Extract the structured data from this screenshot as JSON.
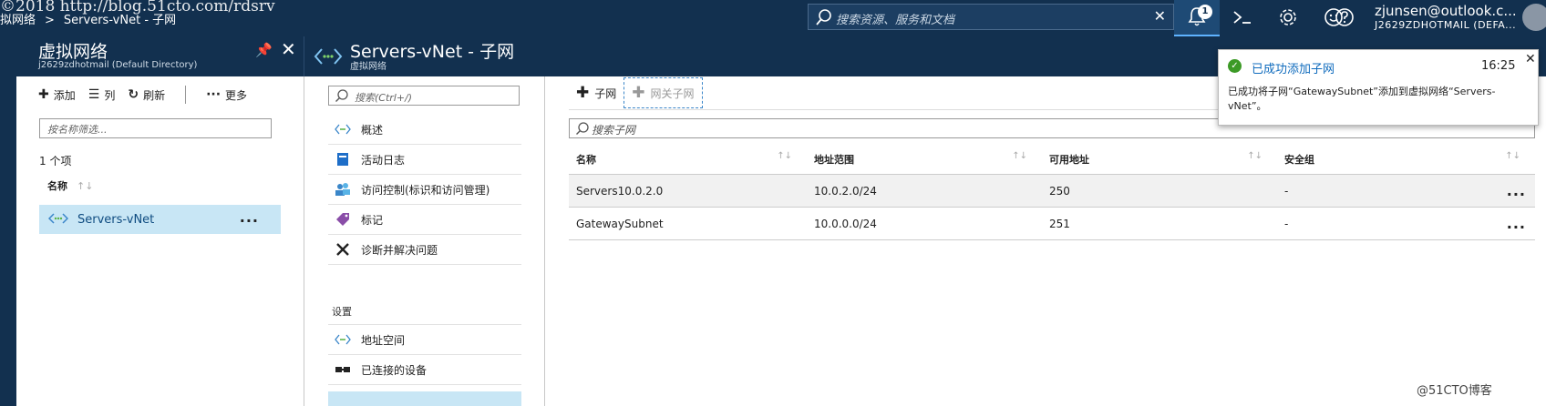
{
  "watermark": "©2018 http://blog.51cto.com/rdsrv",
  "breadcrumb": {
    "item1": "拟网络",
    "separator": ">",
    "item2": "Servers-vNet - 子网"
  },
  "global_search": {
    "placeholder": "搜索资源、服务和文档"
  },
  "notifications": {
    "count": "1"
  },
  "user": {
    "email": "zjunsen@outlook.c...",
    "directory": "J2629ZDHOTMAIL (DEFA..."
  },
  "blade1": {
    "title": "虚拟网络",
    "subtitle": "j2629zdhotmail (Default Directory)",
    "toolbar": {
      "add": "添加",
      "columns": "列",
      "refresh": "刷新",
      "more": "更多"
    },
    "filter_placeholder": "按名称筛选...",
    "count": "1 个项",
    "column_name": "名称",
    "sort_glyph": "↑↓",
    "rows": [
      {
        "name": "Servers-vNet",
        "more": "..."
      }
    ]
  },
  "blade2": {
    "title": "Servers-vNet - 子网",
    "subtitle": "虚拟网络",
    "menu_search_placeholder": "搜索(Ctrl+/)",
    "menu": {
      "overview": "概述",
      "activity_log": "活动日志",
      "access_control": "访问控制(标识和访问管理)",
      "tags": "标记",
      "diagnose": "诊断并解决问题",
      "section_settings": "设置",
      "address_space": "地址空间",
      "connected_devices": "已连接的设备"
    },
    "toolbar": {
      "add_subnet": "子网",
      "add_gateway_subnet": "网关子网"
    },
    "search_placeholder": "搜索子网",
    "columns": {
      "name": "名称",
      "address_range": "地址范围",
      "available": "可用地址",
      "nsg": "安全组"
    },
    "sort_glyph": "↑↓",
    "rows": [
      {
        "name": "Servers10.0.2.0",
        "range": "10.0.2.0/24",
        "available": "250",
        "nsg": "-",
        "more": "..."
      },
      {
        "name": "GatewaySubnet",
        "range": "10.0.0.0/24",
        "available": "251",
        "nsg": "-",
        "more": "..."
      }
    ]
  },
  "toast": {
    "title": "已成功添加子网",
    "time": "16:25",
    "message": "已成功将子网“GatewaySubnet”添加到虚拟网络“Servers-vNet”。"
  },
  "footer_watermark": "@51CTO博客",
  "colors": {
    "header": "#12304f",
    "accent": "#0f6bbd",
    "selected": "#c8e6f5",
    "success": "#3c9a26"
  }
}
